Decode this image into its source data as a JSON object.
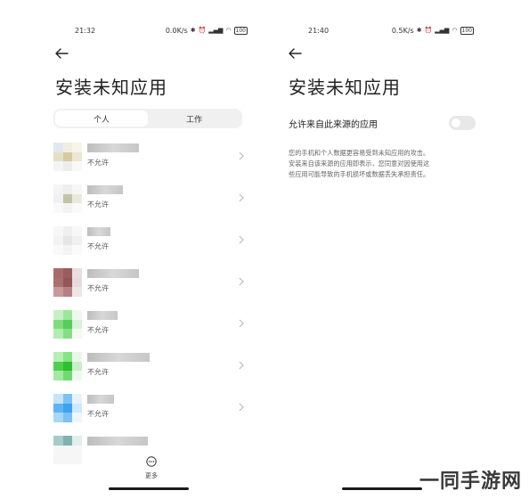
{
  "left_screen": {
    "status": {
      "time": "21:32",
      "net_speed": "0.0K/s",
      "battery": "100"
    },
    "title": "安装未知应用",
    "tabs": [
      {
        "label": "个人",
        "active": true
      },
      {
        "label": "工作",
        "active": false
      }
    ],
    "apps": [
      {
        "status": "不允许",
        "icon_colors": [
          "#dfe9f1",
          "#f2eedf",
          "#f7f4ea",
          "#e6dfc6",
          "#d8c9a0",
          "#ede6d2",
          "#f4f4f4",
          "#ececec",
          "#f8f8f8"
        ],
        "name_width": 58
      },
      {
        "status": "不允许",
        "icon_colors": [
          "#f4f4f4",
          "#eeeeee",
          "#f7f7f7",
          "#f1f1f1",
          "#c2c4a8",
          "#eaeadc",
          "#f9f9f9",
          "#f3f3f3",
          "#fafafa"
        ],
        "name_width": 40
      },
      {
        "status": "不允许",
        "icon_colors": [
          "#f7f7f7",
          "#efefef",
          "#f7f7f7",
          "#f3f3f3",
          "#e5e5e5",
          "#f0f0f0",
          "#f9f9f9",
          "#f3f3f3",
          "#fafafa"
        ],
        "name_width": 26
      },
      {
        "status": "不允许",
        "icon_colors": [
          "#a86b6b",
          "#9a5c5c",
          "#e9dede",
          "#a97070",
          "#925656",
          "#e7dada",
          "#c99898",
          "#b58080",
          "#efe6e6"
        ],
        "name_width": 58
      },
      {
        "status": "不允许",
        "icon_colors": [
          "#c7f0c7",
          "#9be89b",
          "#eef9ee",
          "#7fdc7f",
          "#58cc58",
          "#d8f3d8",
          "#b2ecb2",
          "#86dd86",
          "#f1faf1"
        ],
        "name_width": 34
      },
      {
        "status": "不允许",
        "icon_colors": [
          "#b6efb6",
          "#86e486",
          "#eaf8ea",
          "#4fcf4f",
          "#2fbf2f",
          "#c8f0c8",
          "#a3e8a3",
          "#72d972",
          "#eef9ee"
        ],
        "name_width": 70
      },
      {
        "status": "不允许",
        "icon_colors": [
          "#c3e4fb",
          "#7cc3f4",
          "#e6f3fd",
          "#5fb5f2",
          "#3ba3ee",
          "#cfe8fb",
          "#a9d6f7",
          "#7cc1f3",
          "#eef6fd"
        ],
        "name_width": 30
      },
      {
        "status": "",
        "icon_colors": [
          "#a6cbc9",
          "#7fb3b0",
          "#e2eeed",
          "#f6f6f6",
          "#f6f6f6",
          "#f6f6f6",
          "#f6f6f6",
          "#f6f6f6",
          "#f6f6f6"
        ],
        "name_width": 68
      }
    ],
    "more_label": "更多"
  },
  "right_screen": {
    "status": {
      "time": "21:40",
      "net_speed": "0.5K/s",
      "battery": "100"
    },
    "title": "安装未知应用",
    "toggle_label": "允许来自此来源的应用",
    "toggle_on": false,
    "description_lines": [
      "您的手机和个人数据更容易受到未知应用的攻击。",
      "安装来自该来源的应用即表示，您同意对因使用这",
      "些应用可能导致的手机损坏或数据丢失承担责任。"
    ]
  },
  "watermark": "一同手游网"
}
